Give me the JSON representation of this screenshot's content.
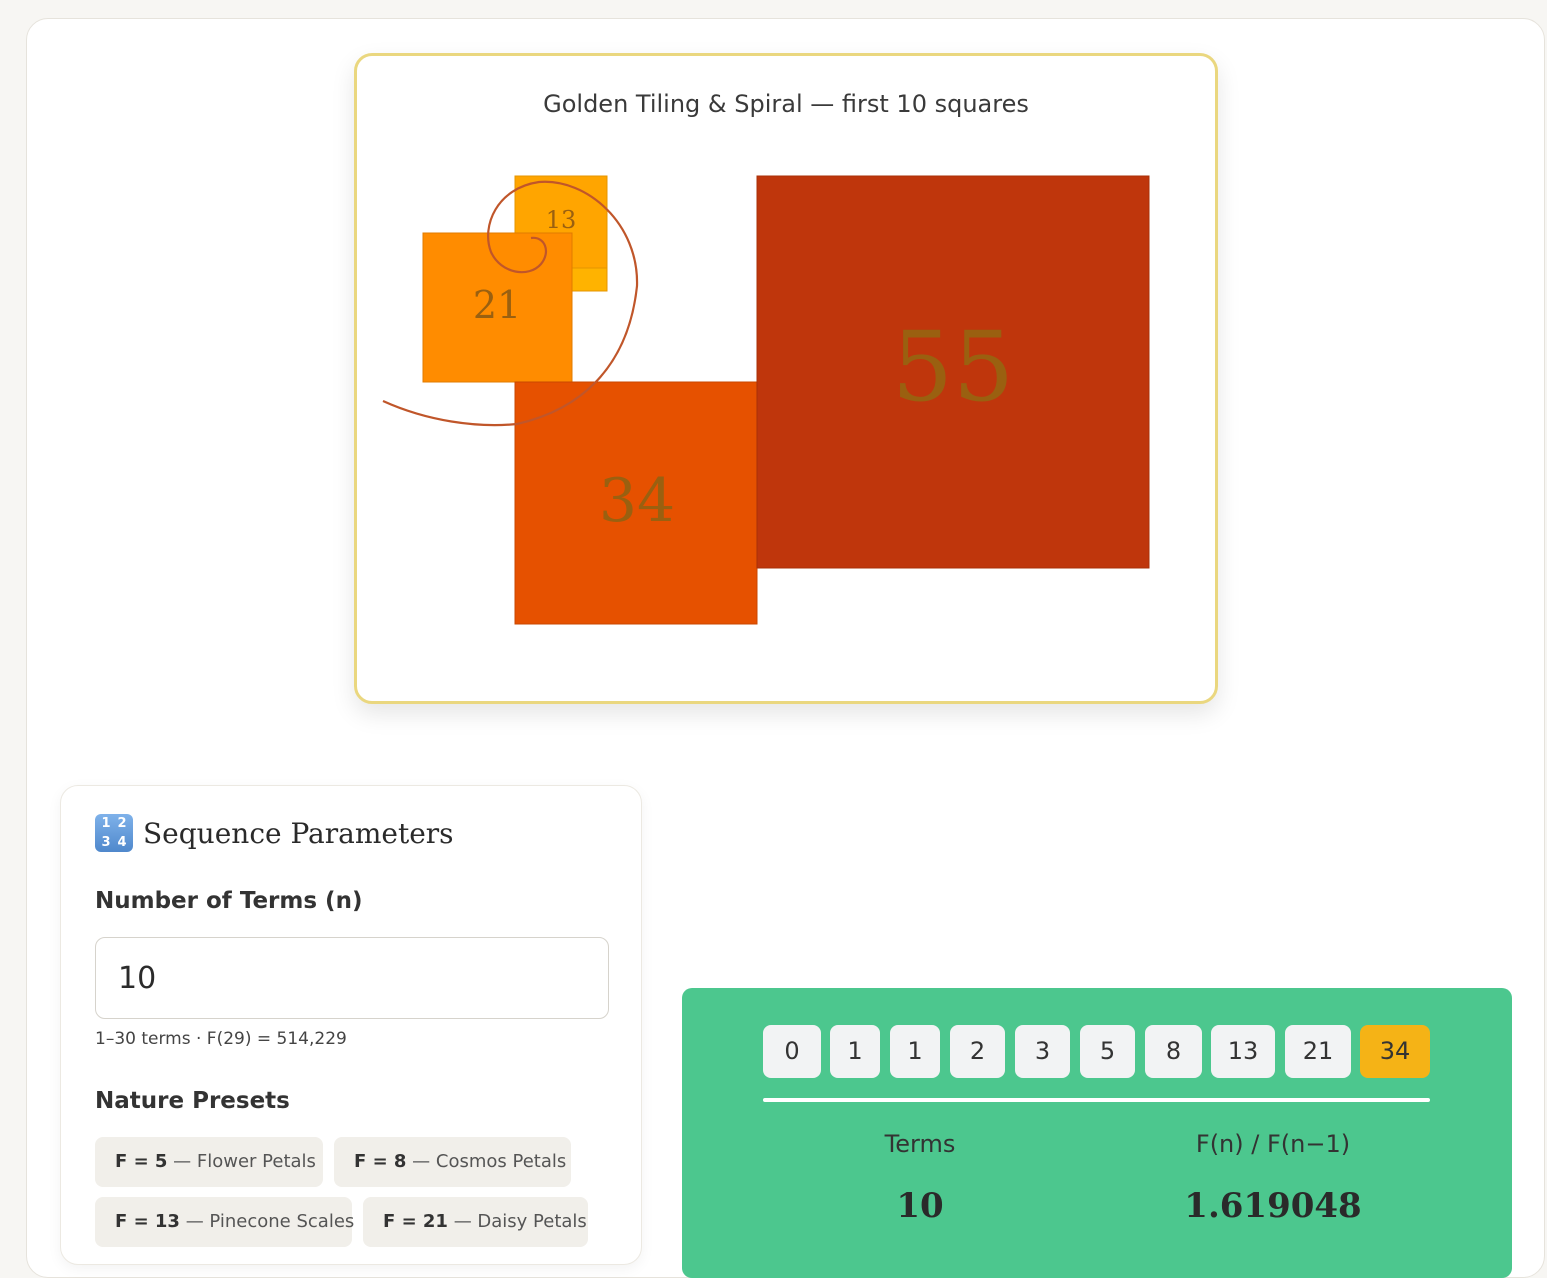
{
  "viz": {
    "title": "Golden Tiling & Spiral — first 10 squares",
    "squares": [
      {
        "value": 13,
        "label": "13",
        "color": "#ffa500"
      },
      {
        "value": 21,
        "label": "21",
        "color": "#ff8c00"
      },
      {
        "value": 34,
        "label": "34",
        "color": "#e65100"
      },
      {
        "value": 55,
        "label": "55",
        "color": "#bf360c"
      }
    ],
    "spiral_color": "#c0562a",
    "label_color": "#9a6010"
  },
  "params": {
    "title": "Sequence Parameters",
    "icon_digits": [
      "1",
      "2",
      "3",
      "4"
    ],
    "terms_label": "Number of Terms (n)",
    "terms_value": "10",
    "hint": "1–30 terms · F(29) = 514,229",
    "presets_label": "Nature Presets",
    "presets": [
      {
        "key": "F = 5",
        "label": " — Flower Petals"
      },
      {
        "key": "F = 8",
        "label": " — Cosmos Petals"
      },
      {
        "key": "F = 13",
        "label": " — Pinecone Scales"
      },
      {
        "key": "F = 21",
        "label": " — Daisy Petals"
      }
    ]
  },
  "results": {
    "sequence": [
      "0",
      "1",
      "1",
      "2",
      "3",
      "5",
      "8",
      "13",
      "21",
      "34"
    ],
    "highlight_index": 9,
    "terms_label": "Terms",
    "terms_value": "10",
    "ratio_label": "F(n) / F(n−1)",
    "ratio_value": "1.619048",
    "background": "#4cc78e",
    "highlight_color": "#f5b316"
  }
}
